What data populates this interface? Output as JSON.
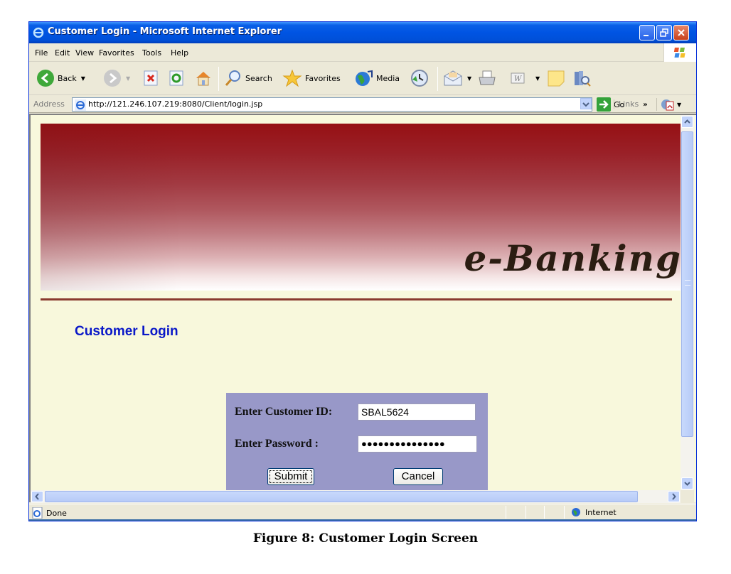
{
  "window": {
    "title": "Customer Login - Microsoft Internet Explorer"
  },
  "menu": {
    "items": [
      "File",
      "Edit",
      "View",
      "Favorites",
      "Tools",
      "Help"
    ]
  },
  "toolbar": {
    "back_label": "Back",
    "search_label": "Search",
    "favorites_label": "Favorites",
    "media_label": "Media"
  },
  "address": {
    "label": "Address",
    "url": "http://121.246.107.219:8080/Client/login.jsp",
    "go_label": "Go",
    "links_label": "Links",
    "links_chevron": "»"
  },
  "page": {
    "banner_title": "e-Banking",
    "section_title": "Customer Login",
    "form": {
      "customer_id_label": "Enter Customer ID:",
      "customer_id_value": "SBAL5624",
      "password_label": "Enter Password :",
      "password_masked": "●●●●●●●●●●●●●●●",
      "submit_label": "Submit",
      "cancel_label": "Cancel"
    }
  },
  "status": {
    "text": "Done",
    "zone": "Internet"
  },
  "caption": "Figure 8: Customer Login Screen",
  "colors": {
    "titlebar": "#0054e3",
    "page_background": "#f8f8dc",
    "banner_red": "#961014",
    "section_title": "#0a18c8",
    "login_panel": "#9898c8",
    "rule": "#8a3a2e"
  }
}
